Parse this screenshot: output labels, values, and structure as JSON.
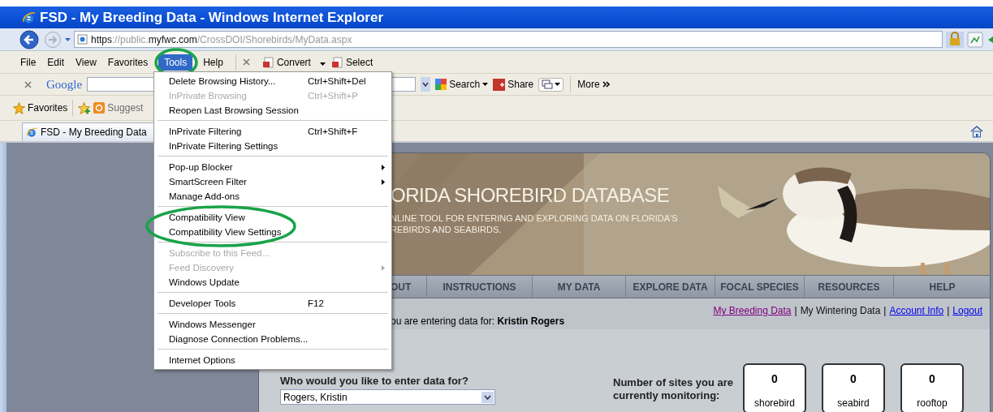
{
  "window": {
    "title": "FSD - My Breeding Data - Windows Internet Explorer"
  },
  "address_bar": {
    "url_parts": [
      {
        "text": "https",
        "strong": true
      },
      {
        "text": "://public.",
        "strong": false
      },
      {
        "text": "myfwc.com",
        "strong": true
      },
      {
        "text": "/CrossDOI/Shorebirds/MyData.aspx",
        "strong": false
      }
    ]
  },
  "menu_bar": {
    "items": [
      {
        "label": "File",
        "selected": false,
        "circled": false
      },
      {
        "label": "Edit",
        "selected": false,
        "circled": false
      },
      {
        "label": "View",
        "selected": false,
        "circled": false
      },
      {
        "label": "Favorites",
        "selected": false,
        "circled": false
      },
      {
        "label": "Tools",
        "selected": true,
        "circled": true
      },
      {
        "label": "Help",
        "selected": false,
        "circled": false
      }
    ]
  },
  "command_bar": {
    "items": [
      {
        "label": "Convert",
        "dropdown": true
      },
      {
        "label": "Select",
        "dropdown": false
      }
    ]
  },
  "google_bar": {
    "logo": "Google",
    "search_label": "Search",
    "share_label": "Share",
    "more_label": "More"
  },
  "favorites_bar": {
    "favorites_label": "Favorites",
    "suggested_label": "Suggest"
  },
  "tabs": [
    {
      "label": "FSD - My Breeding Data",
      "selected": true
    }
  ],
  "tools_menu": {
    "items": [
      {
        "kind": "item",
        "label": "Delete Browsing History...",
        "shortcut": "Ctrl+Shift+Del",
        "disabled": false,
        "submenu": false,
        "circled": false
      },
      {
        "kind": "item",
        "label": "InPrivate Browsing",
        "shortcut": "Ctrl+Shift+P",
        "disabled": true,
        "submenu": false,
        "circled": false
      },
      {
        "kind": "item",
        "label": "Reopen Last Browsing Session",
        "disabled": false,
        "submenu": false,
        "circled": false
      },
      {
        "kind": "separator"
      },
      {
        "kind": "item",
        "label": "InPrivate Filtering",
        "shortcut": "Ctrl+Shift+F",
        "disabled": false,
        "submenu": false,
        "circled": false
      },
      {
        "kind": "item",
        "label": "InPrivate Filtering Settings",
        "disabled": false,
        "submenu": false,
        "circled": false
      },
      {
        "kind": "separator"
      },
      {
        "kind": "item",
        "label": "Pop-up Blocker",
        "disabled": false,
        "submenu": true,
        "circled": false
      },
      {
        "kind": "item",
        "label": "SmartScreen Filter",
        "disabled": false,
        "submenu": true,
        "circled": false
      },
      {
        "kind": "item",
        "label": "Manage Add-ons",
        "disabled": false,
        "submenu": false,
        "circled": false
      },
      {
        "kind": "separator"
      },
      {
        "kind": "item",
        "label": "Compatibility View",
        "disabled": false,
        "submenu": false,
        "circled": true
      },
      {
        "kind": "item",
        "label": "Compatibility View Settings",
        "disabled": false,
        "submenu": false,
        "circled": true
      },
      {
        "kind": "separator"
      },
      {
        "kind": "item",
        "label": "Subscribe to this Feed...",
        "disabled": true,
        "submenu": false,
        "circled": false
      },
      {
        "kind": "item",
        "label": "Feed Discovery",
        "disabled": true,
        "submenu": true,
        "circled": false
      },
      {
        "kind": "item",
        "label": "Windows Update",
        "disabled": false,
        "submenu": false,
        "circled": false
      },
      {
        "kind": "separator"
      },
      {
        "kind": "item",
        "label": "Developer Tools",
        "shortcut": "F12",
        "disabled": false,
        "submenu": false,
        "circled": false
      },
      {
        "kind": "separator"
      },
      {
        "kind": "item",
        "label": "Windows Messenger",
        "disabled": false,
        "submenu": false,
        "circled": false
      },
      {
        "kind": "item",
        "label": "Diagnose Connection Problems...",
        "disabled": false,
        "submenu": false,
        "circled": false
      },
      {
        "kind": "separator"
      },
      {
        "kind": "item",
        "label": "Internet Options",
        "disabled": false,
        "submenu": false,
        "circled": false
      }
    ]
  },
  "page": {
    "banner": {
      "title": "ORIDA SHOREBIRD DATABASE",
      "subtitle_lines": [
        "NLINE TOOL FOR ENTERING AND EXPLORING DATA ON FLORIDA'S",
        "REBIRDS AND SEABIRDS."
      ]
    },
    "nav": [
      {
        "label": "OUT"
      },
      {
        "label": "INSTRUCTIONS"
      },
      {
        "label": "MY DATA"
      },
      {
        "label": "EXPLORE DATA"
      },
      {
        "label": "FOCAL SPECIES"
      },
      {
        "label": "RESOURCES"
      },
      {
        "label": "HELP"
      }
    ],
    "entering_for": "ou are entering data for: **Kristin Rogers**",
    "account_links": [
      {
        "label": "My Breeding Data",
        "kind": "visited"
      },
      {
        "label": "My Wintering Data",
        "kind": "current"
      },
      {
        "label": "Account Info",
        "kind": "link"
      },
      {
        "label": "Logout",
        "kind": "link"
      }
    ],
    "link_separator": "|",
    "who_question": "Who would you like to enter data for?",
    "person_select": {
      "value": "Rogers, Kristin"
    },
    "sites_label": "Number of sites you are currently monitoring:",
    "site_counts": [
      {
        "count": "0",
        "label": "shorebird"
      },
      {
        "count": "0",
        "label": "seabird"
      },
      {
        "count": "0",
        "label": "rooftop"
      }
    ]
  }
}
